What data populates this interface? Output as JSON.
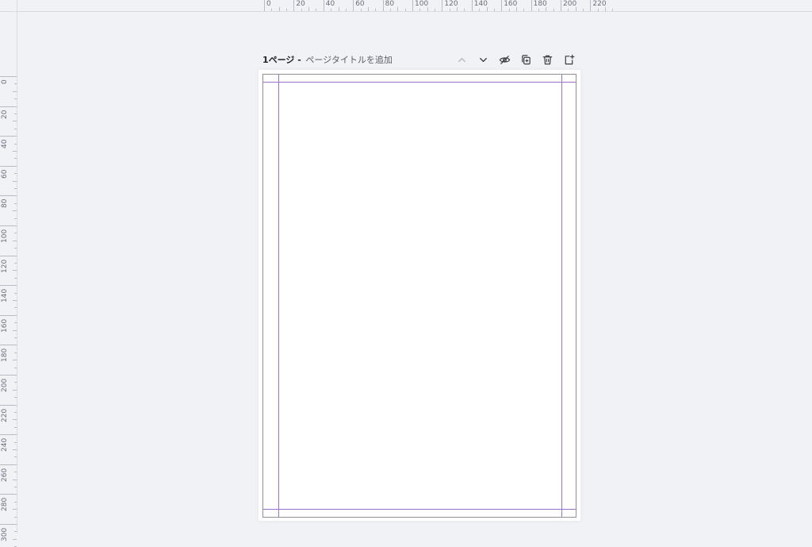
{
  "ruler_top_labels": [
    "0",
    "20",
    "40",
    "60",
    "80",
    "100",
    "120",
    "140",
    "160",
    "180",
    "200",
    "220"
  ],
  "ruler_left_labels": [
    "0",
    "20",
    "40",
    "60",
    "80",
    "100",
    "120",
    "140",
    "160",
    "180",
    "200",
    "220",
    "240",
    "260",
    "280",
    "300"
  ],
  "page": {
    "number_label": "1ページ",
    "separator": " -",
    "title_placeholder": "ページタイトルを追加"
  },
  "page_actions": [
    {
      "name": "move-up-icon"
    },
    {
      "name": "move-down-icon"
    },
    {
      "name": "hide-page-icon"
    },
    {
      "name": "duplicate-page-icon"
    },
    {
      "name": "delete-page-icon"
    },
    {
      "name": "add-page-icon"
    }
  ],
  "colors": {
    "background": "#f1f2f6",
    "guide": "#9a73c9",
    "page_border": "#8f8f95"
  }
}
